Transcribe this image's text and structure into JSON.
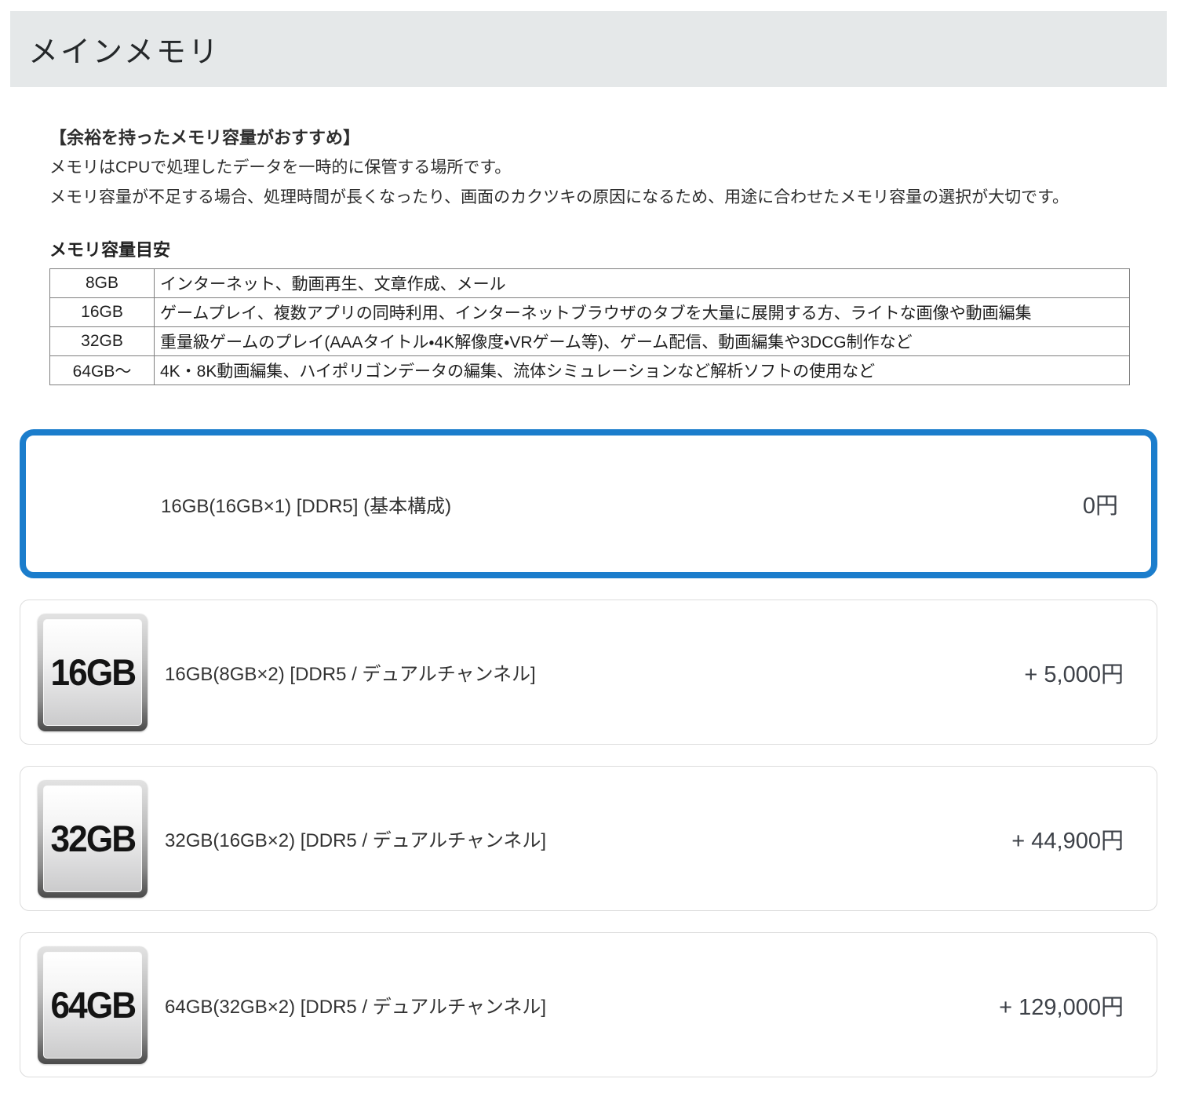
{
  "page": {
    "title": "メインメモリ"
  },
  "intro": {
    "heading": "【余裕を持ったメモリ容量がおすすめ】",
    "line1": "メモリはCPUで処理したデータを一時的に保管する場所です。",
    "line2": "メモリ容量が不足する場合、処理時間が長くなったり、画面のカクツキの原因になるため、用途に合わせたメモリ容量の選択が大切です。"
  },
  "capacity_table": {
    "title": "メモリ容量目安",
    "rows": [
      {
        "capacity": "8GB",
        "usage": "インターネット、動画再生、文章作成、メール"
      },
      {
        "capacity": "16GB",
        "usage": "ゲームプレイ、複数アプリの同時利用、インターネットブラウザのタブを大量に展開する方、ライトな画像や動画編集"
      },
      {
        "capacity": "32GB",
        "usage": "重量級ゲームのプレイ(AAAタイトル・4K解像度・VRゲーム等)、ゲーム配信、動画編集や3DCG制作など"
      },
      {
        "capacity": "64GB～",
        "usage": "4K・8K動画編集、ハイポリゴンデータの編集、流体シミュレーションなど解析ソフトの使用など"
      }
    ]
  },
  "options": {
    "selected": {
      "label": "16GB(16GB×1) [DDR5] (基本構成)",
      "price": "0円"
    },
    "items": [
      {
        "badge": "16GB",
        "label": "16GB(8GB×2) [DDR5 / デュアルチャンネル]",
        "price": "+ 5,000円"
      },
      {
        "badge": "32GB",
        "label": "32GB(16GB×2) [DDR5 / デュアルチャンネル]",
        "price": "+ 44,900円"
      },
      {
        "badge": "64GB",
        "label": "64GB(32GB×2) [DDR5 / デュアルチャンネル]",
        "price": "+ 129,000円"
      }
    ]
  },
  "colors": {
    "selected_border": "#1b7dcc",
    "header_bg": "#e5e8e9",
    "card_border": "#dcdcdc"
  }
}
